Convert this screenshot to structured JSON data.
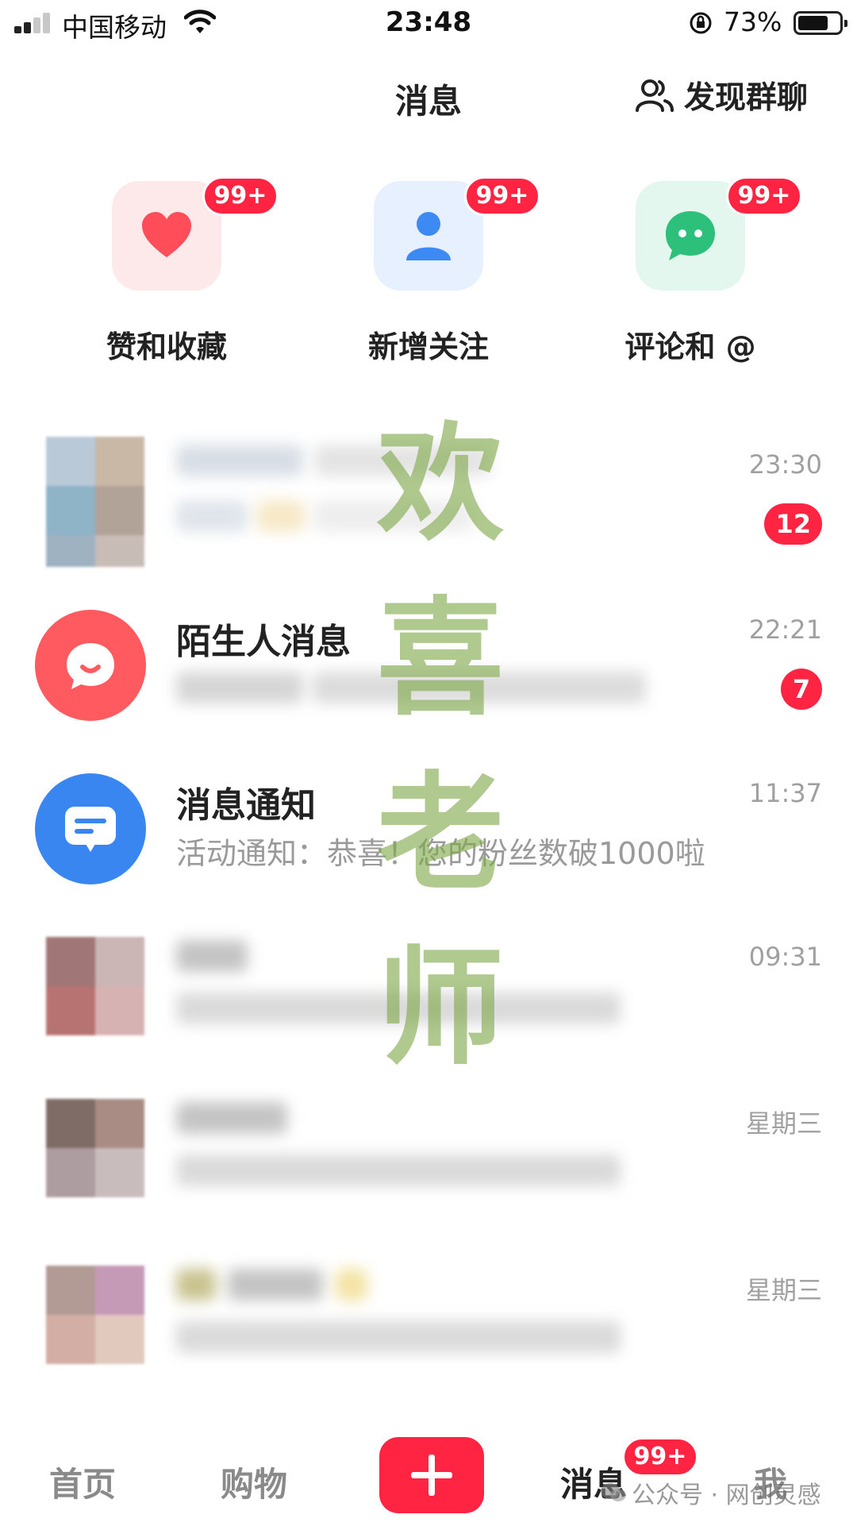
{
  "status_bar": {
    "carrier": "中国移动",
    "time": "23:48",
    "battery_percent": "73%",
    "battery_level": 0.73,
    "signal_bars": 2
  },
  "header": {
    "title": "消息",
    "discover_group_label": "发现群聊",
    "discover_icon": "people-icon"
  },
  "categories": [
    {
      "label": "赞和收藏",
      "badge": "99+",
      "icon": "heart-icon",
      "icon_color": "#ff4d5a",
      "tile_color": "#fde8ea"
    },
    {
      "label": "新增关注",
      "badge": "99+",
      "icon": "person-icon",
      "icon_color": "#3d8af5",
      "tile_color": "#e6f0fe"
    },
    {
      "label": "评论和 @",
      "badge": "99+",
      "icon": "chat-bubble-icon",
      "icon_color": "#2dc07a",
      "tile_color": "#e4f7ee"
    }
  ],
  "messages": [
    {
      "name": "",
      "preview": "",
      "time": "23:30",
      "unread": "12",
      "blurred": true
    },
    {
      "name": "陌生人消息",
      "preview": "",
      "time": "22:21",
      "unread": "7",
      "icon": "stranger-chat-icon",
      "icon_color": "#ff5a5f"
    },
    {
      "name": "消息通知",
      "preview": "活动通知：恭喜！您的粉丝数破1000啦",
      "time": "11:37",
      "icon": "notification-icon",
      "icon_color": "#3a86f0"
    },
    {
      "name": "",
      "preview": "",
      "time": "09:31",
      "blurred": true
    },
    {
      "name": "",
      "preview": "",
      "time": "星期三",
      "blurred": true
    },
    {
      "name": "",
      "preview": "",
      "time": "星期三",
      "blurred": true
    }
  ],
  "watermark": {
    "chars": [
      "欢",
      "喜",
      "老",
      "师"
    ],
    "footer": "公众号 · 网创灵感"
  },
  "tab_bar": {
    "home": "首页",
    "shop": "购物",
    "messages": "消息",
    "messages_badge": "99+",
    "me": "我",
    "accent": "#ff2442"
  }
}
